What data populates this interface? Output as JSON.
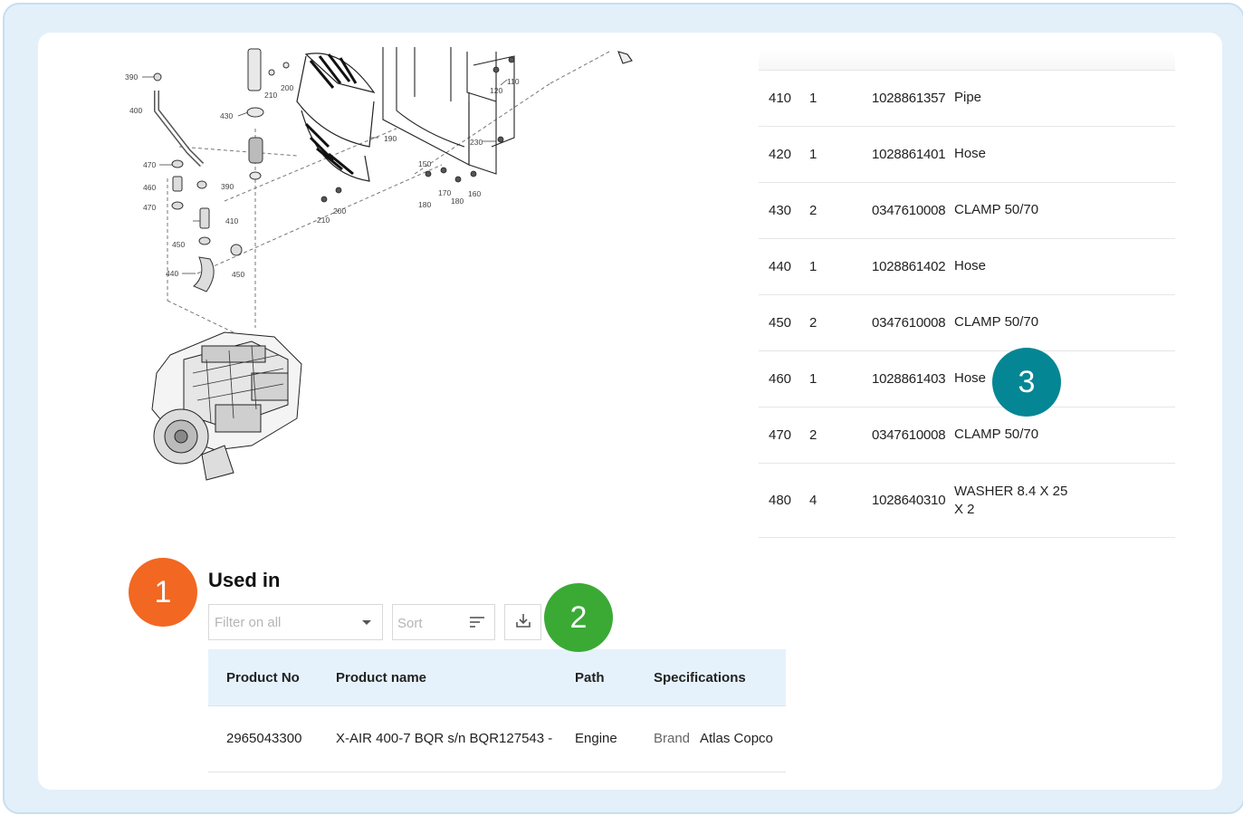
{
  "drawing_labels": {
    "l390a": "390",
    "l400": "400",
    "l470a": "470",
    "l460": "460",
    "l470b": "470",
    "l450a": "450",
    "l440": "440",
    "l450b": "450",
    "l410": "410",
    "l390b": "390",
    "l210a": "210",
    "l200a": "200",
    "l430": "430",
    "l190": "190",
    "l150": "150",
    "l170": "170",
    "l180a": "180",
    "l180b": "180",
    "l160": "160",
    "l230": "230",
    "l120": "120",
    "l110": "110",
    "l200b": "200",
    "l210b": "210"
  },
  "parts": [
    {
      "pos": "410",
      "qty": "1",
      "number": "1028861357",
      "desc": "Pipe"
    },
    {
      "pos": "420",
      "qty": "1",
      "number": "1028861401",
      "desc": "Hose"
    },
    {
      "pos": "430",
      "qty": "2",
      "number": "0347610008",
      "desc": "CLAMP 50/70"
    },
    {
      "pos": "440",
      "qty": "1",
      "number": "1028861402",
      "desc": "Hose"
    },
    {
      "pos": "450",
      "qty": "2",
      "number": "0347610008",
      "desc": "CLAMP 50/70"
    },
    {
      "pos": "460",
      "qty": "1",
      "number": "1028861403",
      "desc": "Hose"
    },
    {
      "pos": "470",
      "qty": "2",
      "number": "0347610008",
      "desc": "CLAMP 50/70"
    },
    {
      "pos": "480",
      "qty": "4",
      "number": "1028640310",
      "desc": "WASHER 8.4 X 25 X 2"
    }
  ],
  "callouts": {
    "one": "1",
    "two": "2",
    "three": "3"
  },
  "colors": {
    "callout_1": "#f26722",
    "callout_2": "#3aaa35",
    "callout_3": "#058694",
    "frame": "#e3f0f9",
    "table_header": "#e6f2fb"
  },
  "used_in": {
    "title": "Used in",
    "filter_placeholder": "Filter on all",
    "sort_placeholder": "Sort",
    "download_icon": "download-icon",
    "columns": {
      "product_no": "Product No",
      "product_name": "Product name",
      "path": "Path",
      "specifications": "Specifications"
    },
    "rows": [
      {
        "product_no": "2965043300",
        "product_name": "X-AIR 400-7 BQR s/n BQR127543 -",
        "path": "Engine",
        "spec_key": "Brand",
        "spec_value": "Atlas Copco"
      }
    ]
  }
}
